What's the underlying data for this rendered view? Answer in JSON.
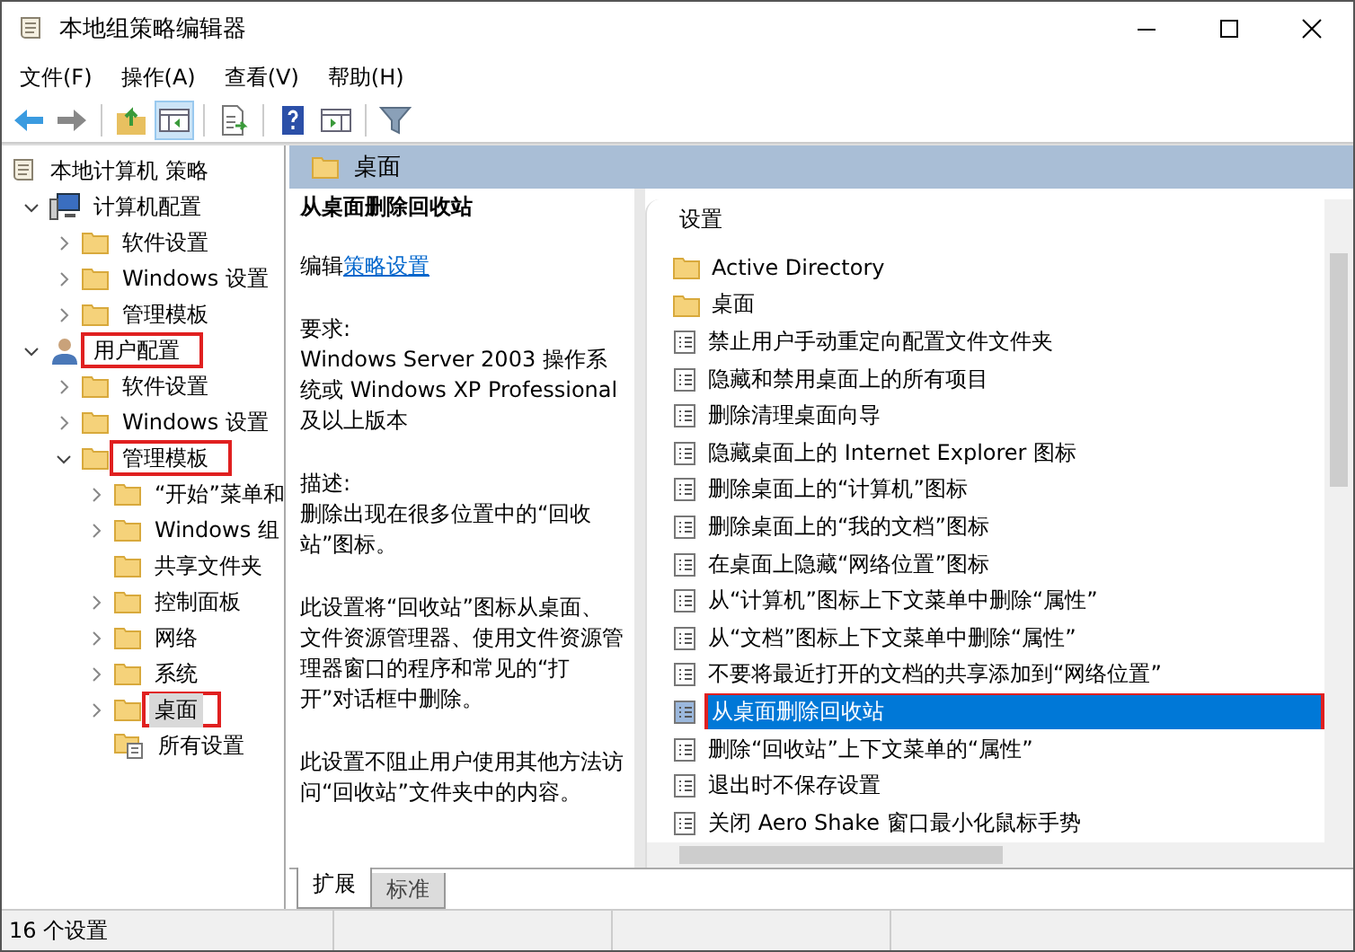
{
  "window": {
    "title": "本地组策略编辑器"
  },
  "menu": [
    "文件(F)",
    "操作(A)",
    "查看(V)",
    "帮助(H)"
  ],
  "toolbar": [
    {
      "kind": "back",
      "pressed": false
    },
    {
      "kind": "forward",
      "pressed": false
    },
    {
      "kind": "sep"
    },
    {
      "kind": "up",
      "pressed": false
    },
    {
      "kind": "pane",
      "pressed": true
    },
    {
      "kind": "sep"
    },
    {
      "kind": "export",
      "pressed": false
    },
    {
      "kind": "sep"
    },
    {
      "kind": "help",
      "pressed": false
    },
    {
      "kind": "view",
      "pressed": false
    },
    {
      "kind": "sep"
    },
    {
      "kind": "filter",
      "pressed": false
    }
  ],
  "tree": [
    {
      "label": "本地计算机 策略",
      "kind": "policy",
      "selected": false,
      "highlighted": false,
      "children": [
        {
          "label": "计算机配置",
          "kind": "computer",
          "expanded": true,
          "selected": false,
          "highlighted": false,
          "children": [
            {
              "label": "软件设置",
              "kind": "folder",
              "expanded": false,
              "selected": false,
              "highlighted": false
            },
            {
              "label": "Windows 设置",
              "kind": "folder",
              "expanded": false,
              "selected": false,
              "highlighted": false
            },
            {
              "label": "管理模板",
              "kind": "folder",
              "expanded": false,
              "selected": false,
              "highlighted": false
            }
          ]
        },
        {
          "label": "用户配置",
          "kind": "user",
          "expanded": true,
          "selected": false,
          "highlighted": true,
          "children": [
            {
              "label": "软件设置",
              "kind": "folder",
              "expanded": false,
              "selected": false,
              "highlighted": false
            },
            {
              "label": "Windows 设置",
              "kind": "folder",
              "expanded": false,
              "selected": false,
              "highlighted": false
            },
            {
              "label": "管理模板",
              "kind": "folder",
              "expanded": true,
              "selected": false,
              "highlighted": true,
              "children": [
                {
                  "label": "“开始”菜单和",
                  "kind": "folder",
                  "expanded": false,
                  "selected": false,
                  "highlighted": false
                },
                {
                  "label": "Windows 组",
                  "kind": "folder",
                  "expanded": false,
                  "selected": false,
                  "highlighted": false
                },
                {
                  "label": "共享文件夹",
                  "kind": "leaf-folder",
                  "selected": false,
                  "highlighted": false
                },
                {
                  "label": "控制面板",
                  "kind": "folder",
                  "expanded": false,
                  "selected": false,
                  "highlighted": false
                },
                {
                  "label": "网络",
                  "kind": "folder",
                  "expanded": false,
                  "selected": false,
                  "highlighted": false
                },
                {
                  "label": "系统",
                  "kind": "folder",
                  "expanded": false,
                  "selected": false,
                  "highlighted": false
                },
                {
                  "label": "桌面",
                  "kind": "folder",
                  "expanded": false,
                  "selected": true,
                  "highlighted": true
                },
                {
                  "label": "所有设置",
                  "kind": "all-settings",
                  "selected": false,
                  "highlighted": false
                }
              ]
            }
          ]
        }
      ]
    }
  ],
  "header": {
    "title": "桌面"
  },
  "description": {
    "title": "从桌面删除回收站",
    "edit_label": "编辑",
    "edit_link": "策略设置",
    "requirements_label": "要求:",
    "requirements": "Windows Server 2003 操作系统或 Windows XP Professional 及以上版本",
    "description_label": "描述:",
    "paragraphs": [
      "删除出现在很多位置中的“回收站”图标。",
      "此设置将“回收站”图标从桌面、文件资源管理器、使用文件资源管理器窗口的程序和常见的“打开”对话框中删除。",
      "此设置不阻止用户使用其他方法访问“回收站”文件夹中的内容。"
    ]
  },
  "list": {
    "column": "设置",
    "items": [
      {
        "label": "Active Directory",
        "kind": "folder",
        "selected": false,
        "highlighted": false
      },
      {
        "label": "桌面",
        "kind": "folder",
        "selected": false,
        "highlighted": false
      },
      {
        "label": "禁止用户手动重定向配置文件文件夹",
        "kind": "setting",
        "selected": false,
        "highlighted": false
      },
      {
        "label": "隐藏和禁用桌面上的所有项目",
        "kind": "setting",
        "selected": false,
        "highlighted": false
      },
      {
        "label": "删除清理桌面向导",
        "kind": "setting",
        "selected": false,
        "highlighted": false
      },
      {
        "label": "隐藏桌面上的 Internet Explorer 图标",
        "kind": "setting",
        "selected": false,
        "highlighted": false
      },
      {
        "label": "删除桌面上的“计算机”图标",
        "kind": "setting",
        "selected": false,
        "highlighted": false
      },
      {
        "label": "删除桌面上的“我的文档”图标",
        "kind": "setting",
        "selected": false,
        "highlighted": false
      },
      {
        "label": "在桌面上隐藏“网络位置”图标",
        "kind": "setting",
        "selected": false,
        "highlighted": false
      },
      {
        "label": "从“计算机”图标上下文菜单中删除“属性”",
        "kind": "setting",
        "selected": false,
        "highlighted": false
      },
      {
        "label": "从“文档”图标上下文菜单中删除“属性”",
        "kind": "setting",
        "selected": false,
        "highlighted": false
      },
      {
        "label": "不要将最近打开的文档的共享添加到“网络位置”",
        "kind": "setting",
        "selected": false,
        "highlighted": false
      },
      {
        "label": "从桌面删除回收站",
        "kind": "setting",
        "selected": true,
        "highlighted": true
      },
      {
        "label": "删除“回收站”上下文菜单的“属性”",
        "kind": "setting",
        "selected": false,
        "highlighted": false
      },
      {
        "label": "退出时不保存设置",
        "kind": "setting",
        "selected": false,
        "highlighted": false
      },
      {
        "label": "关闭 Aero Shake 窗口最小化鼠标手势",
        "kind": "setting",
        "selected": false,
        "highlighted": false
      }
    ]
  },
  "tabs": [
    {
      "label": "扩展",
      "selected": true
    },
    {
      "label": "标准",
      "selected": false
    }
  ],
  "status_bar": {
    "text": "16 个设置"
  }
}
